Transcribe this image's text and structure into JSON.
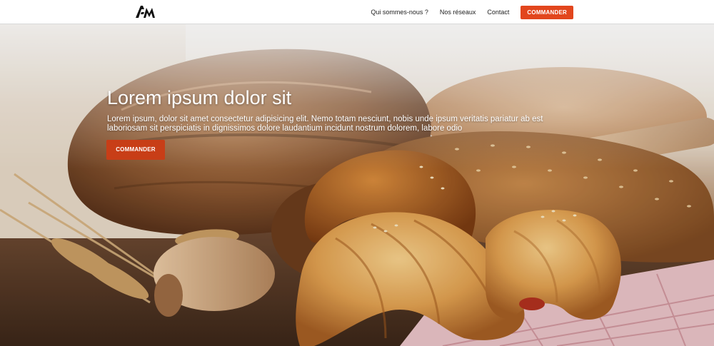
{
  "header": {
    "logo_text": "AM",
    "nav": [
      {
        "label": "Qui sommes-nous ?"
      },
      {
        "label": "Nos réseaux"
      },
      {
        "label": "Contact"
      }
    ],
    "cta_label": "COMMANDER"
  },
  "hero": {
    "title": "Lorem ipsum dolor sit",
    "text": "Lorem ipsum, dolor sit amet consectetur adipisicing elit. Nemo totam nesciunt, nobis unde ipsum veritatis pariatur ab est laboriosam sit perspiciatis in dignissimos dolore laudantium incidunt nostrum dolorem, labore odio",
    "cta_label": "COMMANDER"
  },
  "colors": {
    "accent": "#e2461d",
    "hero_button": "#c83e17",
    "header_bg": "#ffffff"
  },
  "icons": {
    "logo": "am-monogram-logo",
    "background": "bakery-bread-croissant-photo"
  }
}
